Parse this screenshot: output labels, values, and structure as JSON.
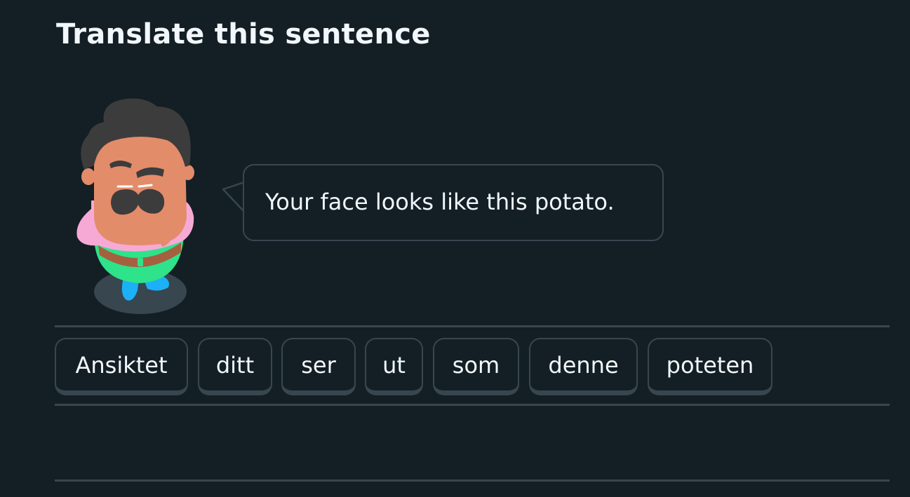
{
  "challenge": {
    "title": "Translate this sentence",
    "prompt": "Your face looks like this potato."
  },
  "word_bank": [
    {
      "label": "Ansiktet"
    },
    {
      "label": "ditt"
    },
    {
      "label": "ser"
    },
    {
      "label": "ut"
    },
    {
      "label": "som"
    },
    {
      "label": "denne"
    },
    {
      "label": "poteten"
    }
  ],
  "colors": {
    "background": "#131f24",
    "border": "#37464f",
    "text": "#f1f7fb"
  },
  "icons": {
    "character": "character-illustration"
  }
}
